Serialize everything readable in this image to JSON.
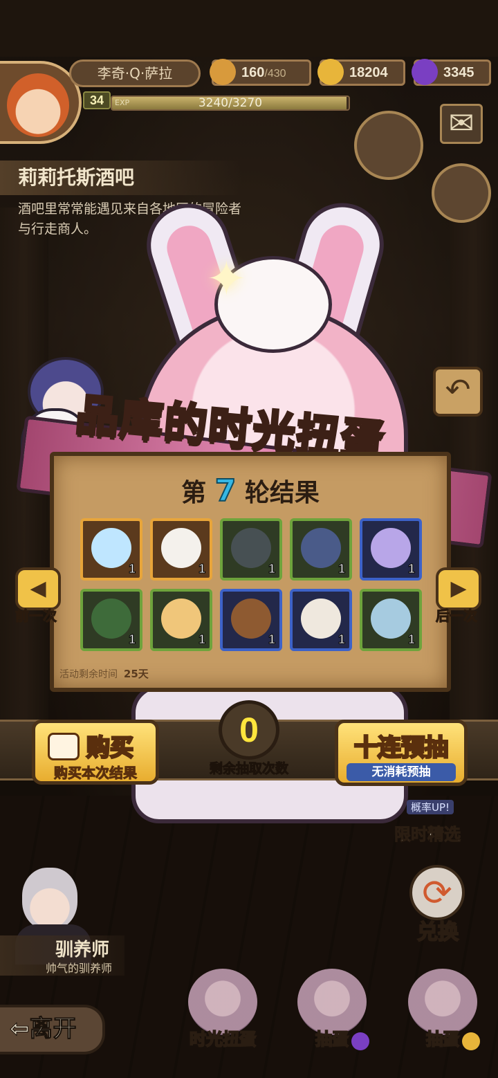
{
  "player": {
    "name": "李奇·Q·萨拉",
    "level": "34",
    "exp_tag": "EXP",
    "exp_text": "3240/3270",
    "exp_fraction": 0.99
  },
  "resources": {
    "stamina": {
      "value": "160",
      "cap": "/430",
      "icon": "bread-icon",
      "color": "#d89a3c"
    },
    "gold": {
      "value": "18204",
      "icon": "gold-coin-icon",
      "color": "#e8b53a"
    },
    "gem": {
      "value": "3345",
      "icon": "purple-gem-icon",
      "color": "#7a3fc2"
    }
  },
  "location": {
    "title": "莉莉托斯酒吧",
    "description": "酒吧里常常能遇见来自各地区的冒险者与行走商人。"
  },
  "banner": {
    "title_pre": "品库的",
    "title_hl": "时光",
    "title_post": "扭蛋"
  },
  "results": {
    "round_prefix": "第",
    "round_number": "7",
    "round_suffix": "轮结果",
    "items": [
      {
        "rarity": "gold",
        "name": "crowned-winged-egg-icon",
        "qty": "1",
        "color": "#bfe6ff"
      },
      {
        "rarity": "gold",
        "name": "angel-winged-egg-icon",
        "qty": "1",
        "color": "#f4f1ec"
      },
      {
        "rarity": "green",
        "name": "turtle-shell-icon",
        "qty": "1",
        "color": "#475053"
      },
      {
        "rarity": "green",
        "name": "clam-shell-icon",
        "qty": "1",
        "color": "#4a5b89"
      },
      {
        "rarity": "blue",
        "name": "purple-slime-icon",
        "qty": "1",
        "color": "#b8a6e8"
      },
      {
        "rarity": "green",
        "name": "lantern-icon",
        "qty": "1",
        "color": "#3e6b3a"
      },
      {
        "rarity": "green",
        "name": "golden-egg-icon",
        "qty": "1",
        "color": "#f0c67a"
      },
      {
        "rarity": "blue",
        "name": "squirrel-berry-icon",
        "qty": "1",
        "color": "#8e5a31"
      },
      {
        "rarity": "blue",
        "name": "owl-egg-icon",
        "qty": "1",
        "color": "#efe8de"
      },
      {
        "rarity": "green",
        "name": "glass-flask-icon",
        "qty": "1",
        "color": "#a6cbe0"
      }
    ],
    "timer_label": "活动剩余时间",
    "timer_value": "25天"
  },
  "nav": {
    "prev": "前一次",
    "next": "后一次"
  },
  "actions": {
    "buy_big": "购买",
    "buy_small": "购买本次结果",
    "remaining_count": "0",
    "remaining_label": "剩余抽取次数",
    "ten_big": "十连预抽",
    "ten_small": "无消耗预抽"
  },
  "side_menu": {
    "limited_tag": "概率UP!",
    "limited_label": "限时精选",
    "exchange_label": "兑换"
  },
  "npc": {
    "name": "驯养师",
    "title": "帅气的驯养师"
  },
  "bottom": {
    "leave": "离开",
    "time_gacha": "时光扭蛋",
    "draw_gem": "抽蛋",
    "draw_gold": "抽蛋"
  }
}
